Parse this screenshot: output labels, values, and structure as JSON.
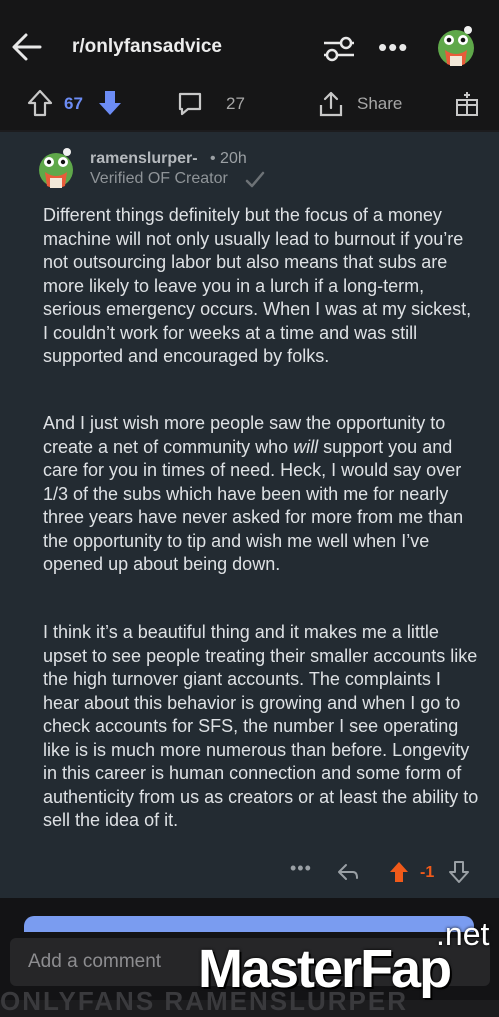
{
  "header": {
    "subreddit": "r/onlyfansadvice",
    "more_label": "•••"
  },
  "post_actions": {
    "vote_count": "67",
    "comment_count": "27",
    "share_label": "Share"
  },
  "comment": {
    "author": "ramenslurper-",
    "time": "• 20h",
    "flair": "Verified OF Creator",
    "paragraphs": {
      "p1": "Different things definitely but the focus of a money machine will not only usually lead to burnout if you’re not outsourcing labor but also means that subs are more likely to leave you in a lurch if a long-term, serious emergency occurs. When I was at my sickest, I couldn’t work for weeks at a time and was still supported and encouraged by folks.",
      "p2_before": "And I just wish more people saw the opportunity to create a net of community who ",
      "p2_em": "will",
      "p2_after": " support you and care for you in times of need. Heck, I would say over 1/3 of the subs which have been with me for nearly three years have never asked for more from me than the opportunity to tip and wish me well when I’ve opened up about being down.",
      "p3": "I think it’s a beautiful thing and it makes me a little upset to see people treating their smaller accounts like the high turnover giant accounts. The complaints I hear about this behavior is growing and when I go to check accounts for SFS, the number I see operating like is is much more numerous than before. Longevity in this career is human connection and some form of authenticity from us as creators or at least the ability to sell the idea of it."
    },
    "more_label": "•••",
    "score": "-1"
  },
  "composer": {
    "placeholder": "Add a comment"
  },
  "ghost_text": "ONLYFANS RAMENSLURPER",
  "watermark": {
    "brand": "MasterFap",
    "tld": ".net"
  },
  "colors": {
    "accent_blue": "#6c8cf5",
    "upvote_orange": "#f05a1a",
    "card_bg": "#232b32"
  }
}
